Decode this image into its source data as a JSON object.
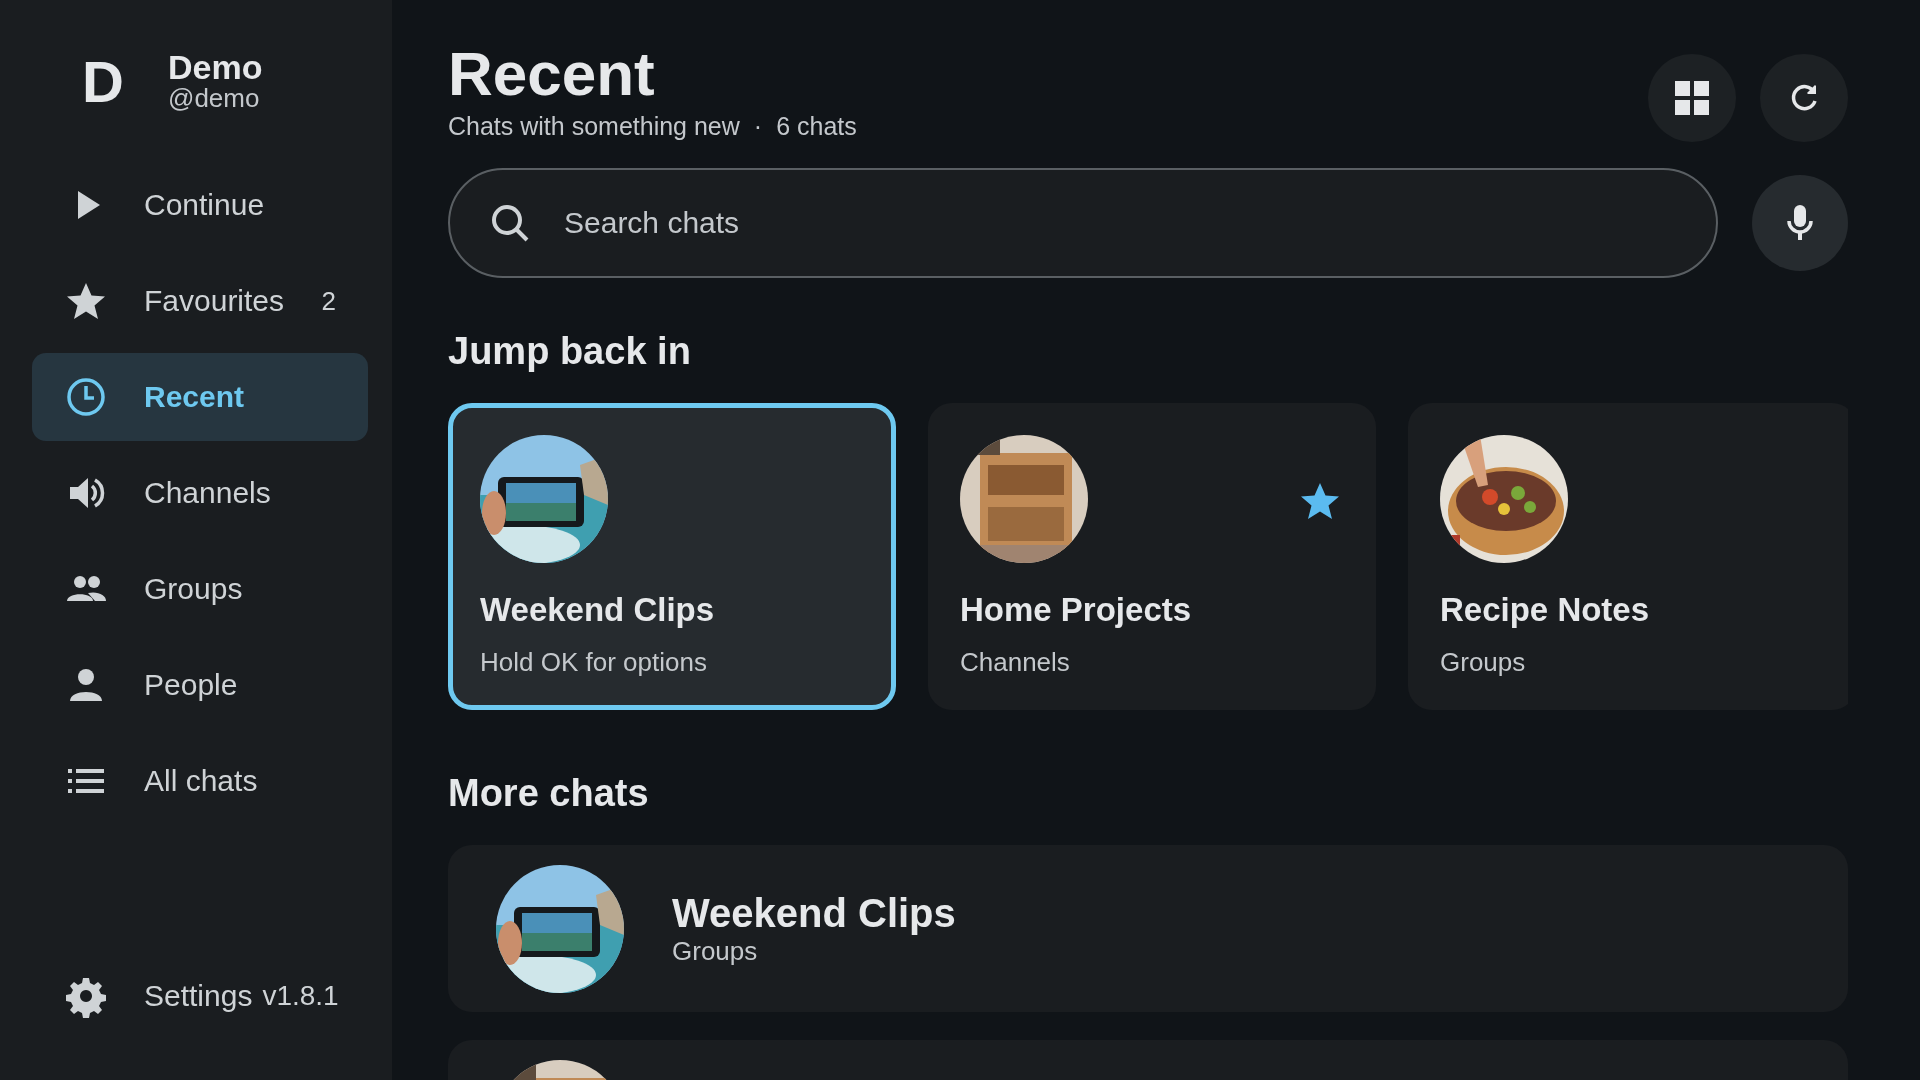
{
  "profile": {
    "initial": "D",
    "name": "Demo",
    "handle": "@demo"
  },
  "nav": [
    {
      "kind": "play",
      "label": "Continue",
      "selected": false
    },
    {
      "kind": "star",
      "label": "Favourites",
      "count": "2",
      "selected": false
    },
    {
      "kind": "clock",
      "label": "Recent",
      "selected": true
    },
    {
      "kind": "speaker",
      "label": "Channels",
      "selected": false
    },
    {
      "kind": "group",
      "label": "Groups",
      "selected": false
    },
    {
      "kind": "person",
      "label": "People",
      "selected": false
    },
    {
      "kind": "list",
      "label": "All chats",
      "selected": false
    }
  ],
  "settings": {
    "label": "Settings",
    "version": "v1.8.1"
  },
  "header": {
    "title": "Recent",
    "subtitle": "Chats with something new",
    "separator": "·",
    "count": "6 chats"
  },
  "search": {
    "placeholder": "Search chats"
  },
  "jump_back": {
    "heading": "Jump back in",
    "cards": [
      {
        "title": "Weekend Clips",
        "subtitle": "Hold OK for options",
        "selected": true,
        "favourite": false
      },
      {
        "title": "Home Projects",
        "subtitle": "Channels",
        "selected": false,
        "favourite": true
      },
      {
        "title": "Recipe Notes",
        "subtitle": "Groups",
        "selected": false,
        "favourite": false
      }
    ]
  },
  "more_chats": {
    "heading": "More chats",
    "rows": [
      {
        "kind": "chat",
        "title": "Weekend Clips",
        "subtitle": "Groups"
      },
      {
        "kind": "chat"
      }
    ]
  }
}
